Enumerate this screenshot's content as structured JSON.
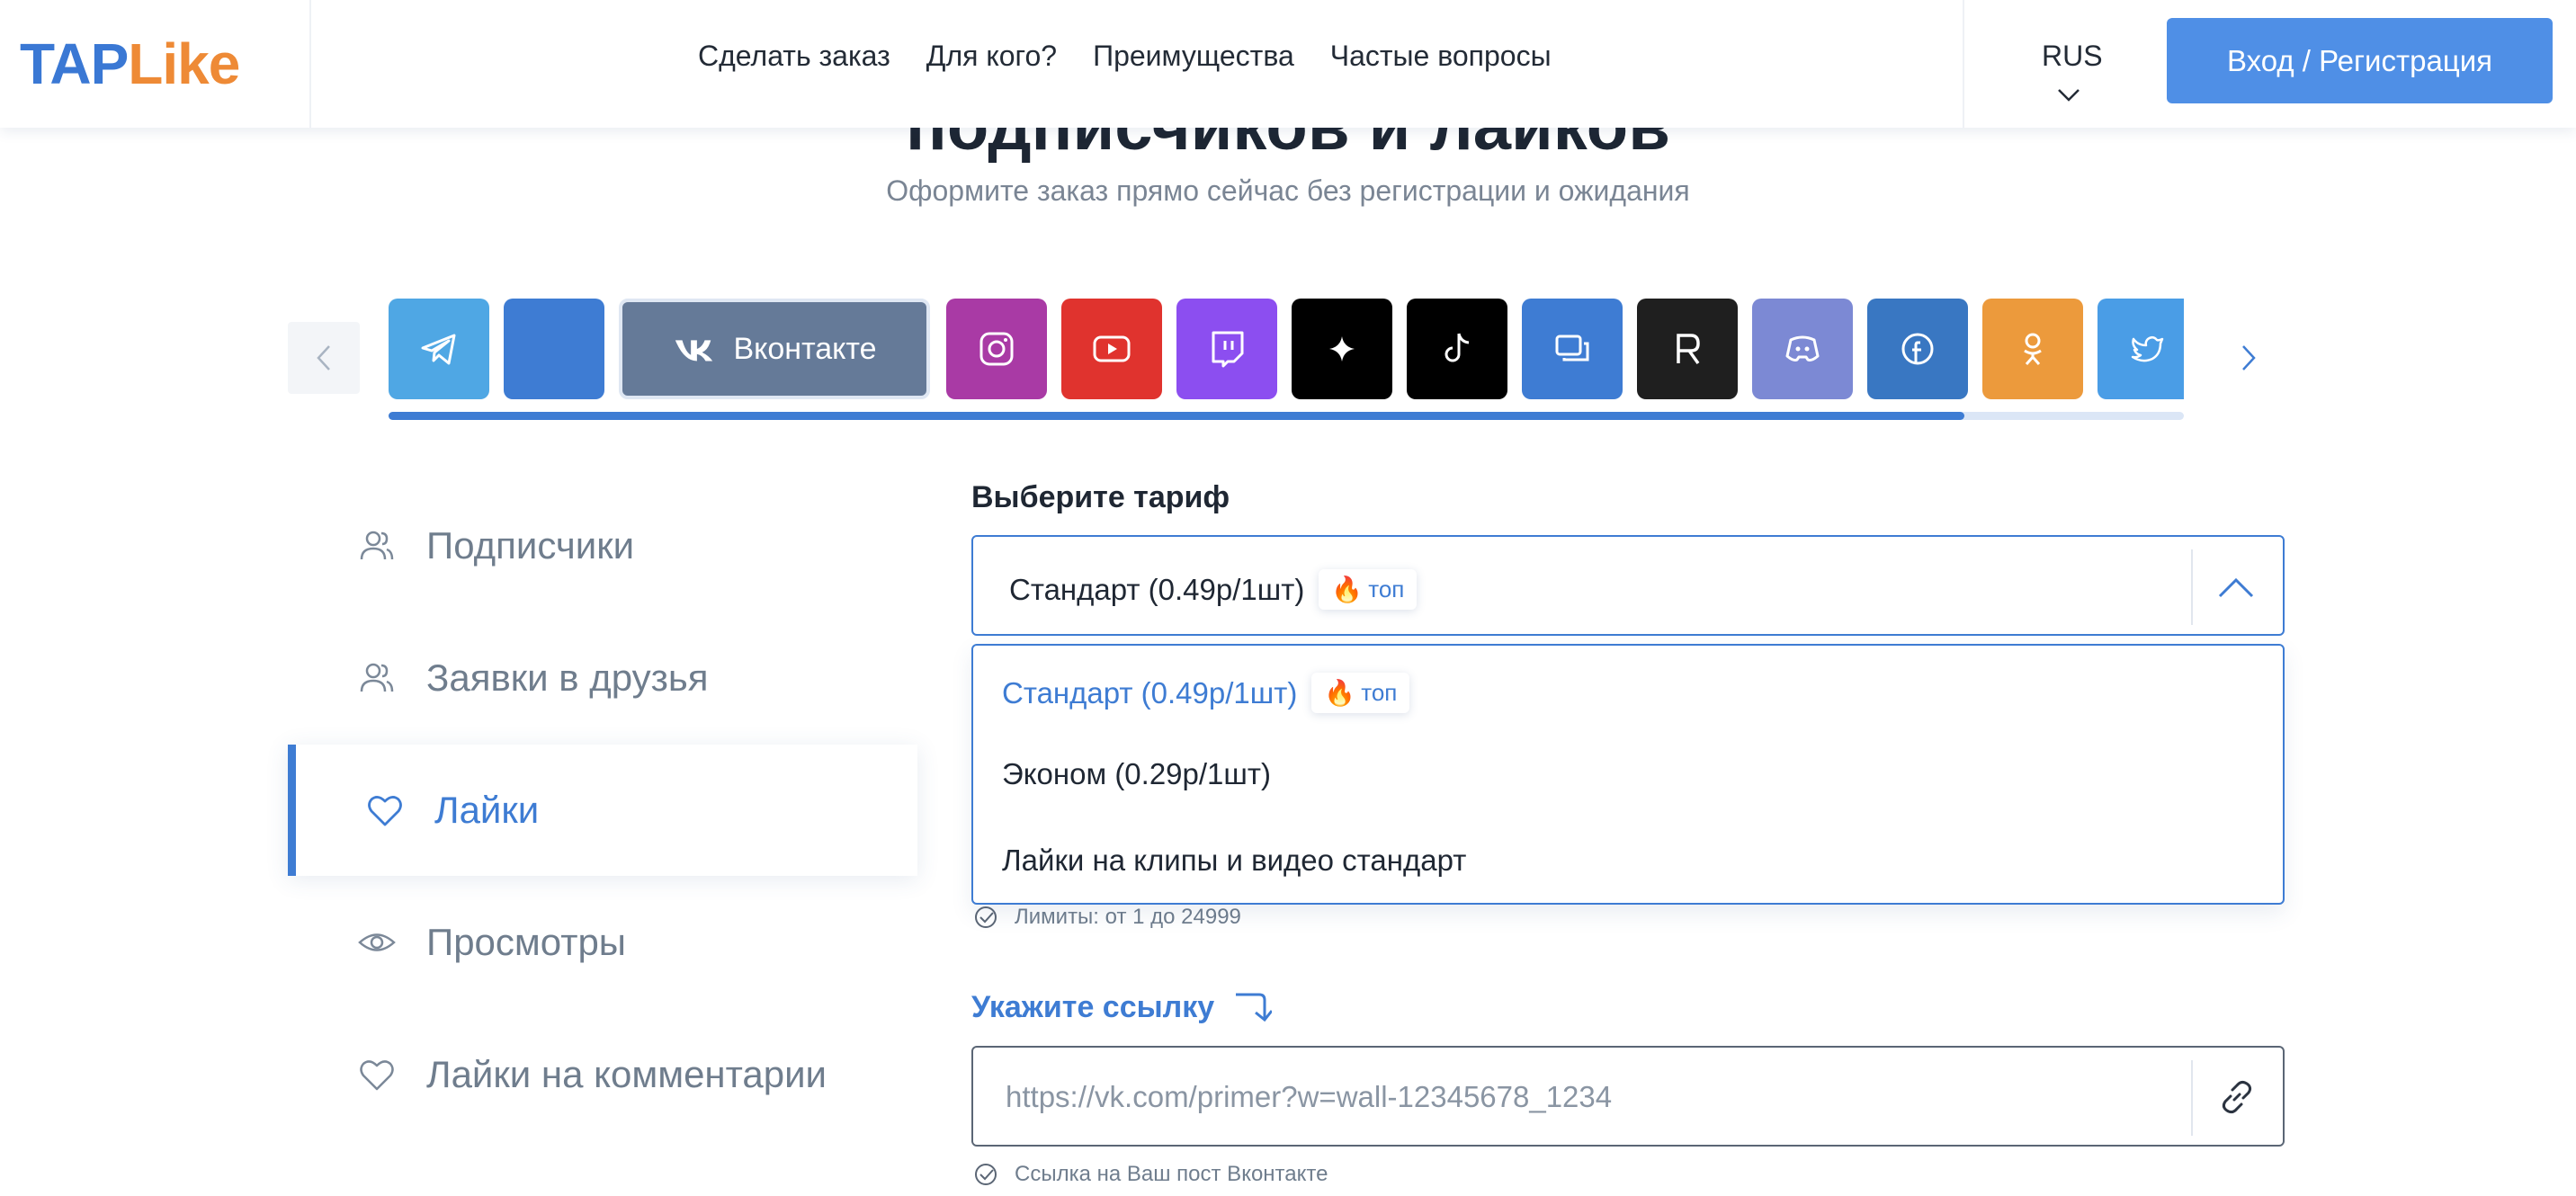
{
  "header": {
    "logo": {
      "part1": "TAP",
      "part2": "Like"
    },
    "nav": [
      "Сделать заказ",
      "Для кого?",
      "Преимущества",
      "Частые вопросы"
    ],
    "language": "RUS",
    "login_label": "Вход / Регистрация"
  },
  "hero": {
    "title": "подписчиков и лайков",
    "subtitle": "Оформите заказ прямо сейчас без регистрации и ожидания"
  },
  "carousel": {
    "selected_label": "Вконтакте",
    "scroll_progress": 0.878,
    "tiles": [
      {
        "icon": "telegram-icon",
        "color": "#4fa7e4"
      },
      {
        "icon": "blank",
        "color": "#3e7cd3"
      },
      {
        "icon": "vk-icon",
        "color": "#657a98"
      },
      {
        "icon": "instagram-icon",
        "color": "#a93aa5"
      },
      {
        "icon": "youtube-icon",
        "color": "#e0332e"
      },
      {
        "icon": "twitch-icon",
        "color": "#8c4ef0"
      },
      {
        "icon": "sparkle-icon",
        "color": "#000000"
      },
      {
        "icon": "tiktok-icon",
        "color": "#000000"
      },
      {
        "icon": "chat-icon",
        "color": "#3e7cd3"
      },
      {
        "icon": "rutube-icon",
        "color": "#1f1f1f"
      },
      {
        "icon": "discord-icon",
        "color": "#7c89d4"
      },
      {
        "icon": "facebook-icon",
        "color": "#3977c2"
      },
      {
        "icon": "odnoklassniki-icon",
        "color": "#ec9a3c"
      },
      {
        "icon": "twitter-icon",
        "color": "#4a9de6"
      }
    ]
  },
  "sidebar": {
    "items": [
      {
        "label": "Подписчики",
        "icon": "users-icon",
        "active": false
      },
      {
        "label": "Заявки в друзья",
        "icon": "users-icon",
        "active": false
      },
      {
        "label": "Лайки",
        "icon": "heart-icon",
        "active": true
      },
      {
        "label": "Просмотры",
        "icon": "eye-icon",
        "active": false
      },
      {
        "label": "Лайки на комментарии",
        "icon": "heart-icon",
        "active": false
      }
    ]
  },
  "form": {
    "tariff_label": "Выберите тариф",
    "selected": "Стандарт (0.49р/1шт)",
    "top_badge": "топ",
    "options": [
      {
        "label": "Стандарт (0.49р/1шт)",
        "badge": "топ",
        "selected": true
      },
      {
        "label": "Эконом (0.29р/1шт)",
        "badge": "",
        "selected": false
      },
      {
        "label": "Лайки на клипы и видео стандарт",
        "badge": "",
        "selected": false
      }
    ],
    "limits_hint": "Лимиты: от 1 до 24999",
    "link_label": "Укажите ссылку",
    "link_placeholder": "https://vk.com/primer?w=wall-12345678_1234",
    "link_hint": "Ссылка на Ваш пост Вконтакте"
  },
  "colors": {
    "accent": "#3e7cd3",
    "login_button": "#4f8fe6",
    "logo_orange": "#ee8a36"
  }
}
